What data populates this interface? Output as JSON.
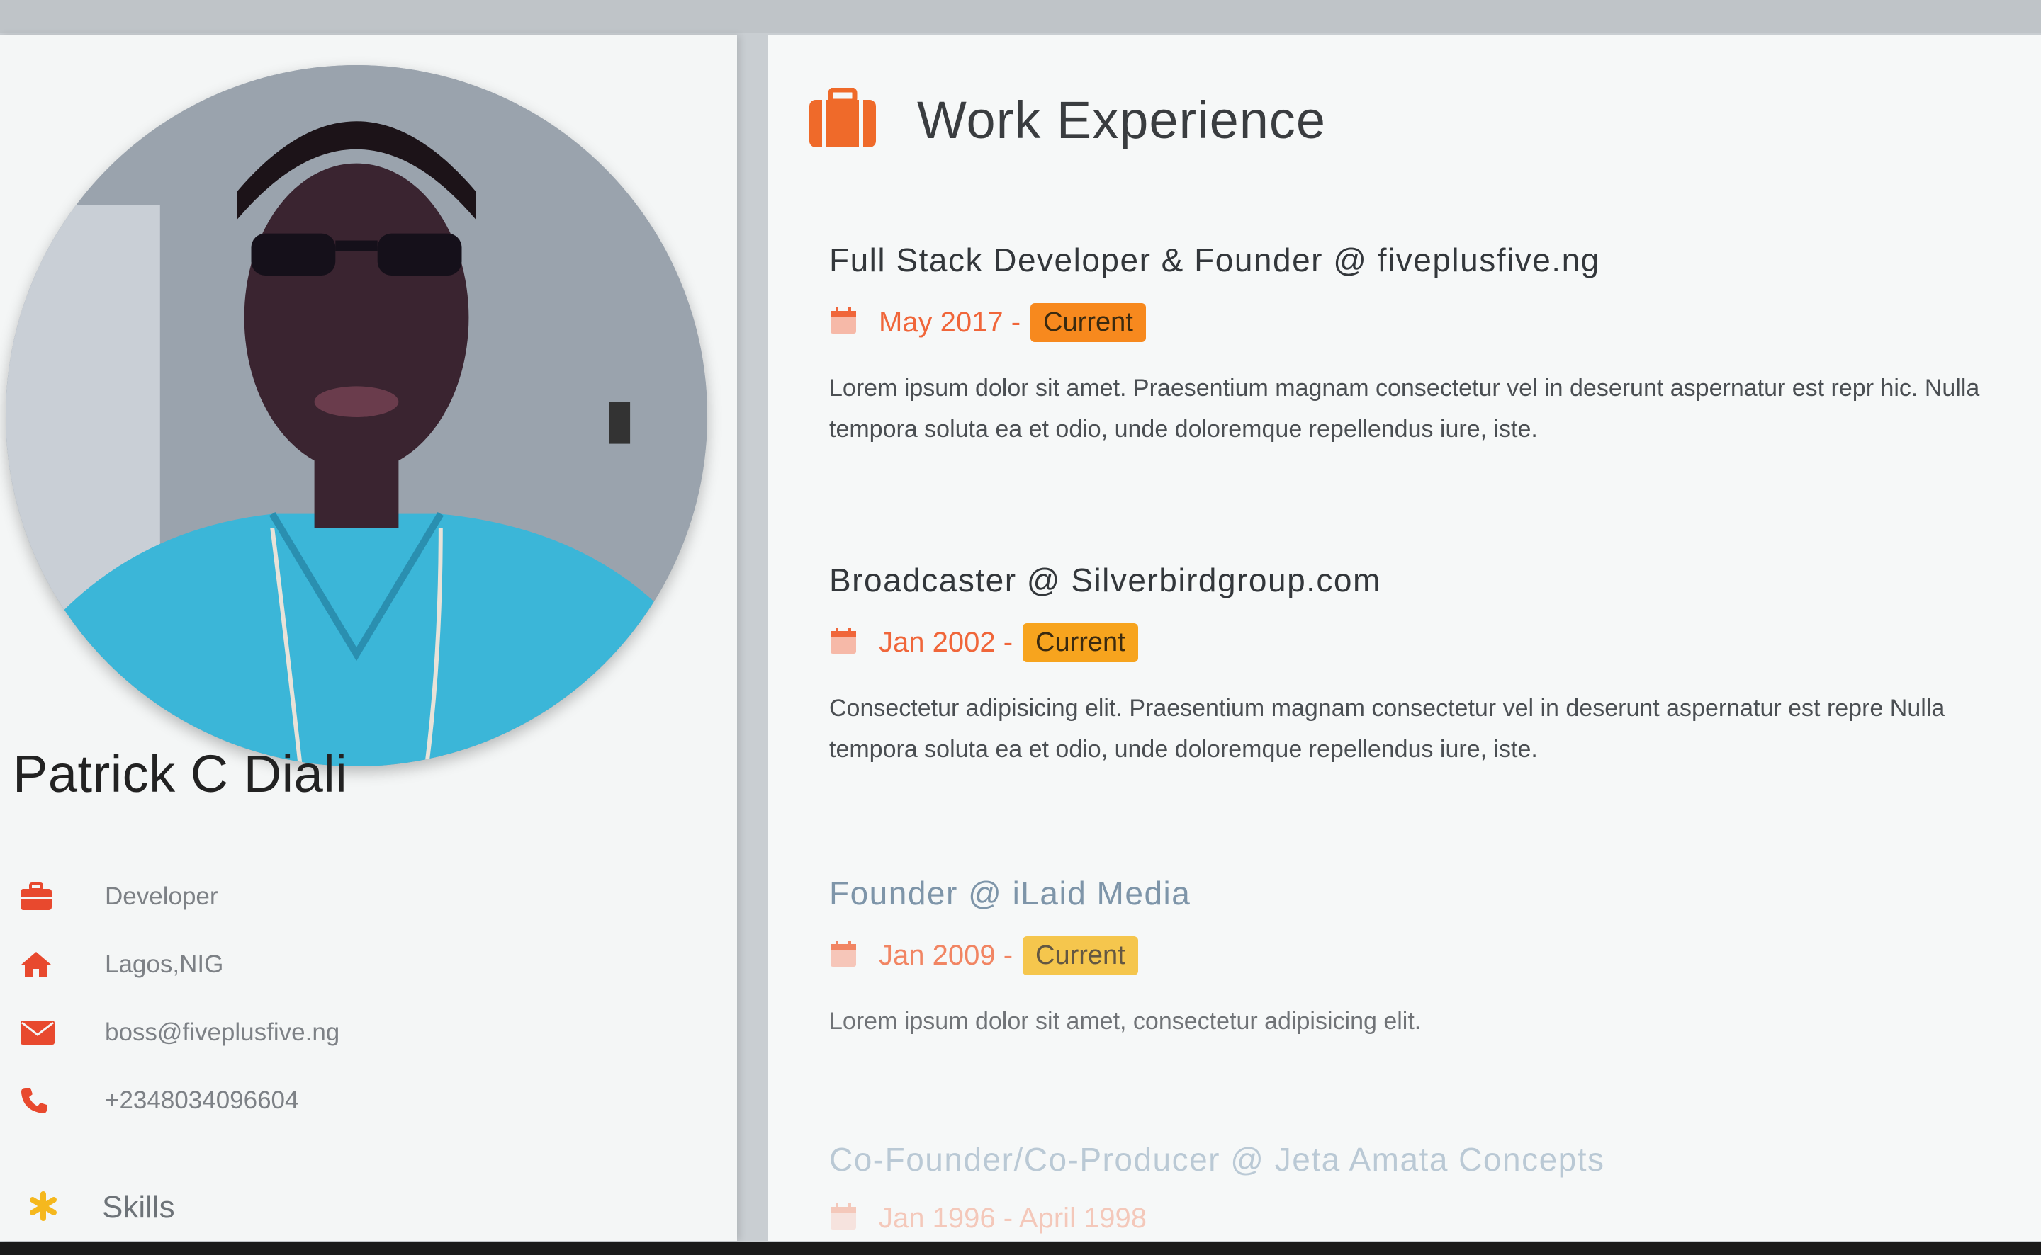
{
  "profile": {
    "name": "Patrick C Diali",
    "info": [
      {
        "icon": "briefcase-icon",
        "text": "Developer"
      },
      {
        "icon": "home-icon",
        "text": "Lagos,NIG"
      },
      {
        "icon": "envelope-icon",
        "text": "boss@fiveplusfive.ng"
      },
      {
        "icon": "phone-icon",
        "text": "+2348034096604"
      }
    ],
    "skills_title": "Skills",
    "skills_icon": "asterisk-icon"
  },
  "experience": {
    "title": "Work Experience",
    "icon": "briefcase-icon",
    "jobs": [
      {
        "title": "Full Stack Developer & Founder @ fiveplusfive.ng",
        "date": "May 2017 -",
        "badge": "Current",
        "badge_color": "#f7891e",
        "desc": "Lorem ipsum dolor sit amet. Praesentium magnam consectetur vel in deserunt aspernatur est repr hic. Nulla tempora soluta ea et odio, unde doloremque repellendus iure, iste."
      },
      {
        "title": "Broadcaster @ Silverbirdgroup.com",
        "date": "Jan 2002 -",
        "badge": "Current",
        "badge_color": "#f7a41e",
        "desc": "Consectetur adipisicing elit. Praesentium magnam consectetur vel in deserunt aspernatur est repre Nulla tempora soluta ea et odio, unde doloremque repellendus iure, iste."
      },
      {
        "title": "Founder @ iLaid Media",
        "date": "Jan 2009 -",
        "badge": "Current",
        "badge_color": "#f5b81e",
        "desc": "Lorem ipsum dolor sit amet, consectetur adipisicing elit."
      },
      {
        "title": "Co-Founder/Co-Producer @ Jeta Amata Concepts",
        "date": "Jan 1996 - April 1998",
        "badge": "",
        "badge_color": "",
        "desc": ""
      }
    ]
  },
  "colors": {
    "accent": "#f0663a",
    "icon_orange": "#e8692e",
    "skills_icon": "#f5b81e"
  }
}
